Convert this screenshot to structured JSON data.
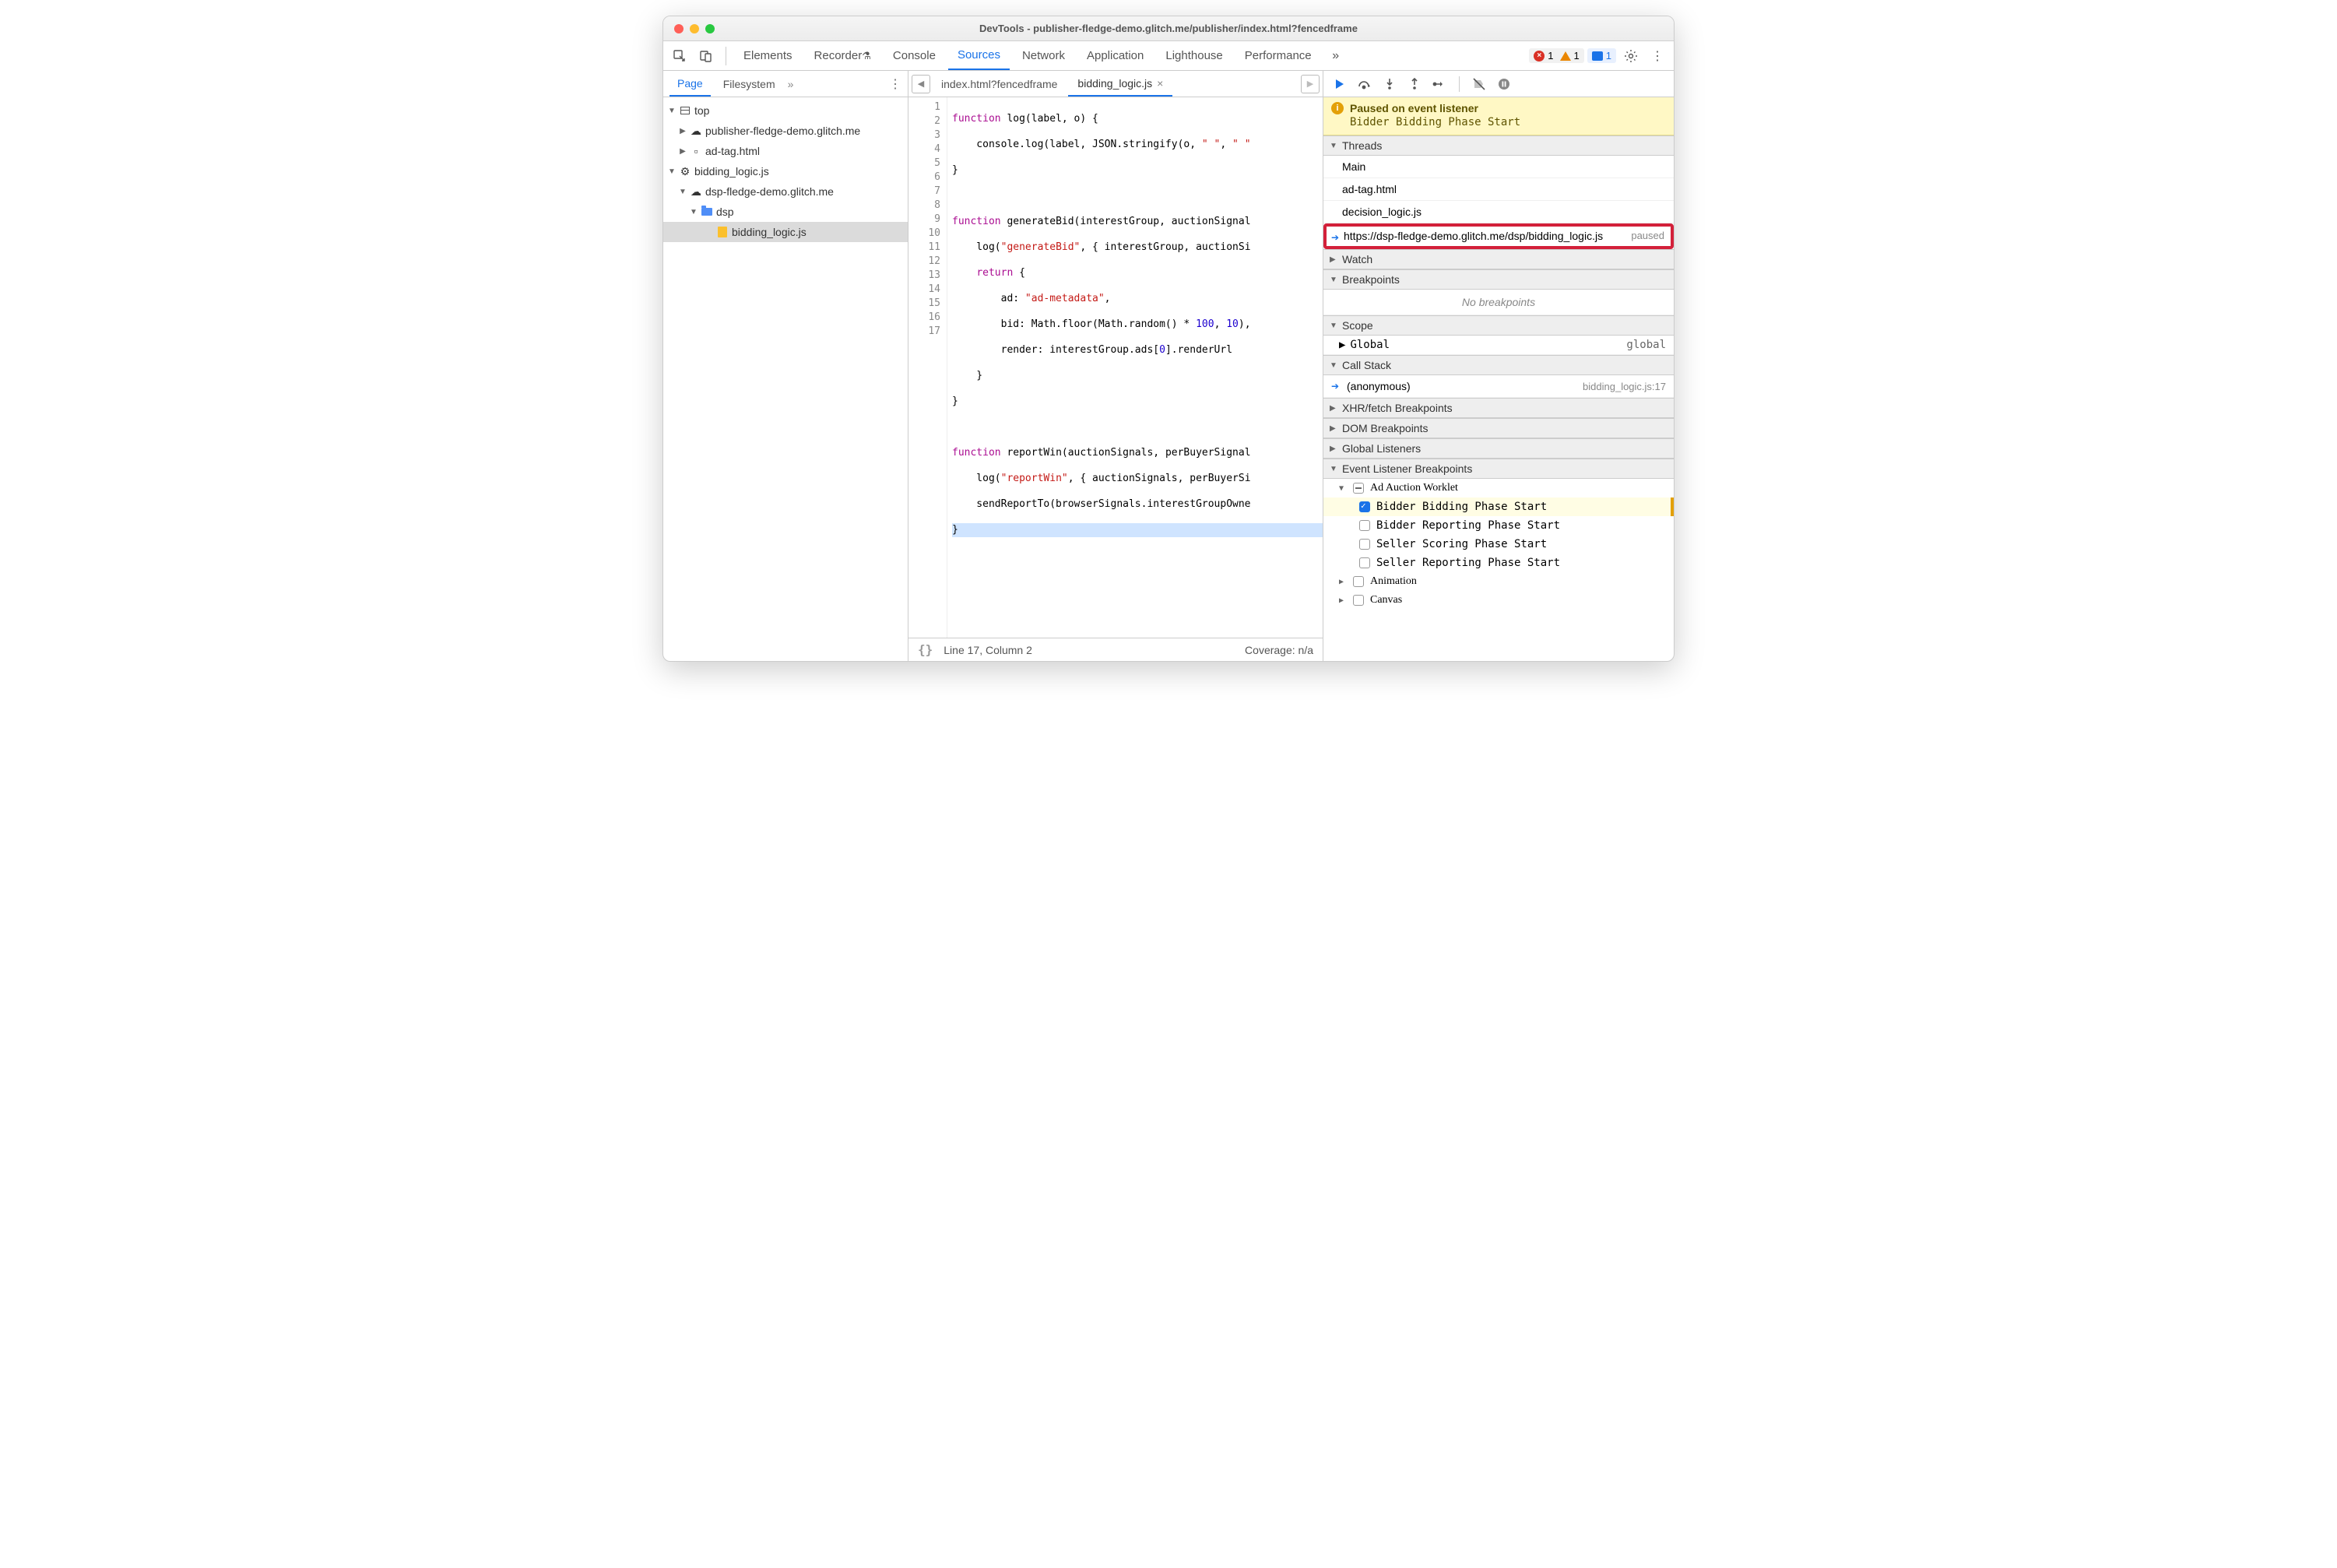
{
  "window_title": "DevTools - publisher-fledge-demo.glitch.me/publisher/index.html?fencedframe",
  "panels": [
    "Elements",
    "Recorder",
    "Console",
    "Sources",
    "Network",
    "Application",
    "Lighthouse",
    "Performance"
  ],
  "active_panel": "Sources",
  "error_count": "1",
  "warn_count": "1",
  "issue_count": "1",
  "sidebar_tabs": [
    "Page",
    "Filesystem"
  ],
  "active_sidebar_tab": "Page",
  "nav_tree": {
    "top": "top",
    "origin1": "publisher-fledge-demo.glitch.me",
    "file1": "ad-tag.html",
    "worklet": "bidding_logic.js",
    "origin2": "dsp-fledge-demo.glitch.me",
    "folder": "dsp",
    "file2": "bidding_logic.js"
  },
  "editor_tabs": [
    {
      "name": "index.html?fencedframe",
      "active": false
    },
    {
      "name": "bidding_logic.js",
      "active": true
    }
  ],
  "code_lines": [
    "function log(label, o) {",
    "    console.log(label, JSON.stringify(o, \" \", \" \"",
    "}",
    "",
    "function generateBid(interestGroup, auctionSignal",
    "    log(\"generateBid\", { interestGroup, auctionSi",
    "    return {",
    "        ad: \"ad-metadata\",",
    "        bid: Math.floor(Math.random() * 100, 10),",
    "        render: interestGroup.ads[0].renderUrl",
    "    }",
    "}",
    "",
    "function reportWin(auctionSignals, perBuyerSignal",
    "    log(\"reportWin\", { auctionSignals, perBuyerSi",
    "    sendReportTo(browserSignals.interestGroupOwne",
    "}"
  ],
  "cursor_status": "Line 17, Column 2",
  "coverage": "Coverage: n/a",
  "paused_title": "Paused on event listener",
  "paused_detail": "Bidder Bidding Phase Start",
  "sections": {
    "threads": "Threads",
    "watch": "Watch",
    "breakpoints": "Breakpoints",
    "scope": "Scope",
    "callstack": "Call Stack",
    "xhr": "XHR/fetch Breakpoints",
    "dom": "DOM Breakpoints",
    "global": "Global Listeners",
    "evl": "Event Listener Breakpoints"
  },
  "threads": [
    "Main",
    "ad-tag.html",
    "decision_logic.js"
  ],
  "thread_highlighted": {
    "label": "https://dsp-fledge-demo.glitch.me/dsp/bidding_logic.js",
    "status": "paused"
  },
  "no_breakpoints": "No breakpoints",
  "scope_global": {
    "label": "Global",
    "value": "global"
  },
  "callstack": {
    "fn": "(anonymous)",
    "loc": "bidding_logic.js:17"
  },
  "evl_group": "Ad Auction Worklet",
  "evl_items": [
    {
      "label": "Bidder Bidding Phase Start",
      "checked": true
    },
    {
      "label": "Bidder Reporting Phase Start",
      "checked": false
    },
    {
      "label": "Seller Scoring Phase Start",
      "checked": false
    },
    {
      "label": "Seller Reporting Phase Start",
      "checked": false
    }
  ],
  "evl_animation": "Animation",
  "evl_canvas": "Canvas"
}
